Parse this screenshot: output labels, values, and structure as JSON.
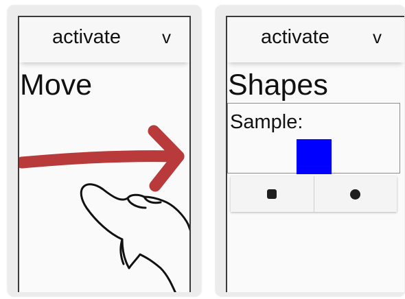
{
  "left_panel": {
    "appbar": {
      "title": "activate",
      "menu_glyph": "v"
    },
    "heading": "Move",
    "gesture": {
      "arrow_icon": "arrow-right-icon",
      "hand_icon": "swipe-hand-icon",
      "arrow_color": "#b83a3a"
    }
  },
  "right_panel": {
    "appbar": {
      "title": "activate",
      "menu_glyph": "v"
    },
    "heading": "Shapes",
    "sample": {
      "label": "Sample:",
      "shape_color": "#0000ff"
    },
    "shape_buttons": [
      {
        "icon": "square-icon"
      },
      {
        "icon": "circle-icon"
      }
    ]
  }
}
